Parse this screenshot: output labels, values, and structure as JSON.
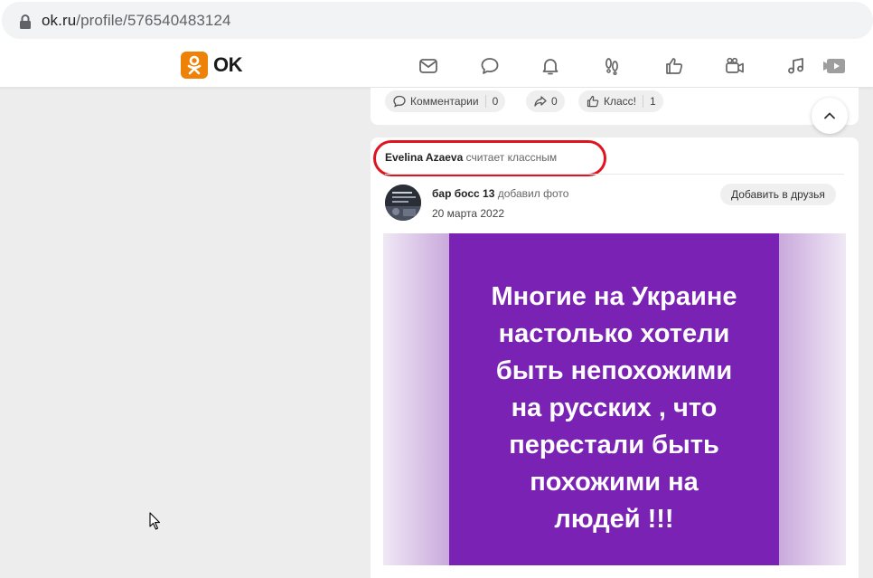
{
  "browser": {
    "url_host": "ok.ru",
    "url_path": "/profile/576540483124"
  },
  "header": {
    "logo_text": "OK",
    "nav_icons": [
      "mail-icon",
      "chat-icon",
      "bell-icon",
      "footprints-icon",
      "thumbs-up-icon",
      "video-camera-icon",
      "music-note-icon",
      "video-play-icon"
    ]
  },
  "prev_post_actions": {
    "comments_label": "Комментарии",
    "comments_count": "0",
    "shares_count": "0",
    "like_label": "Класс!",
    "like_count": "1"
  },
  "post": {
    "liker_name": "Evelina Azaeva",
    "liked_text": "считает классным",
    "author_name": "бар босс 13",
    "action_text": "добавил фото",
    "date": "20 марта 2022",
    "add_friend_label": "Добавить в друзья",
    "image_text": "Многие на Украине\nнастолько хотели\nбыть непохожими\nна русских , что\nперестали быть\nпохожими на\nлюдей !!!"
  },
  "colors": {
    "ok_orange": "#ee8208",
    "highlight_red": "#e0141e",
    "image_purple": "#7a22b4"
  }
}
